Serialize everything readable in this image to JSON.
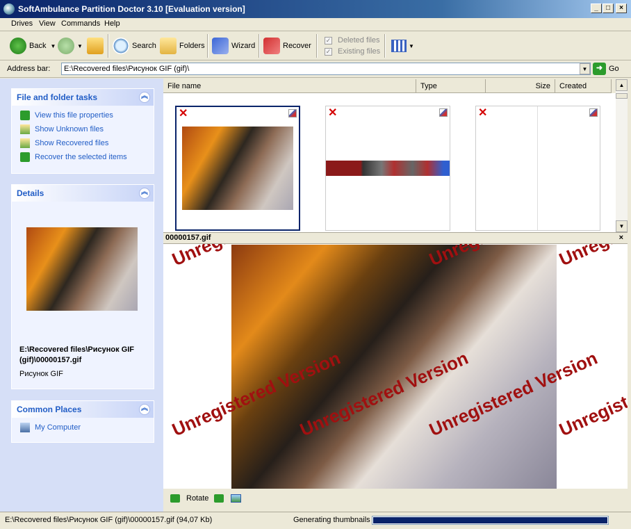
{
  "window": {
    "title": "SoftAmbulance Partition Doctor 3.10 [Evaluation version]"
  },
  "menu": [
    "Drives",
    "View",
    "Commands",
    "Help"
  ],
  "toolbar": {
    "back": "Back",
    "search": "Search",
    "folders": "Folders",
    "wizard": "Wizard",
    "recover": "Recover",
    "deleted_files": "Deleted files",
    "existing_files": "Existing files",
    "deleted_checked": true,
    "existing_checked": true
  },
  "address": {
    "label": "Address bar:",
    "value": "E:\\Recovered files\\Рисунок GIF (gif)\\",
    "go": "Go"
  },
  "tasks_panel": {
    "title": "File and folder tasks",
    "items": [
      "View this file properties",
      "Show Unknown files",
      "Show Recovered files",
      "Recover the selected items"
    ]
  },
  "details_panel": {
    "title": "Details",
    "path": "E:\\Recovered files\\Рисунок GIF (gif)\\00000157.gif",
    "type": "Рисунок GIF"
  },
  "places_panel": {
    "title": "Common Places",
    "items": [
      "My Computer"
    ]
  },
  "list_columns": [
    "File name",
    "Type",
    "Size",
    "Created"
  ],
  "preview": {
    "filename": "00000157.gif",
    "watermark": "Unregistered Version",
    "rotate": "Rotate"
  },
  "status": {
    "path": "E:\\Recovered files\\Рисунок GIF (gif)\\00000157.gif (94,07 Kb)",
    "task": "Generating thumbnails",
    "progress": 1.0
  },
  "colors": {
    "accent": "#215dc6",
    "title": "#0a246a",
    "watermark": "#a01010",
    "progress": "#0a246a"
  }
}
